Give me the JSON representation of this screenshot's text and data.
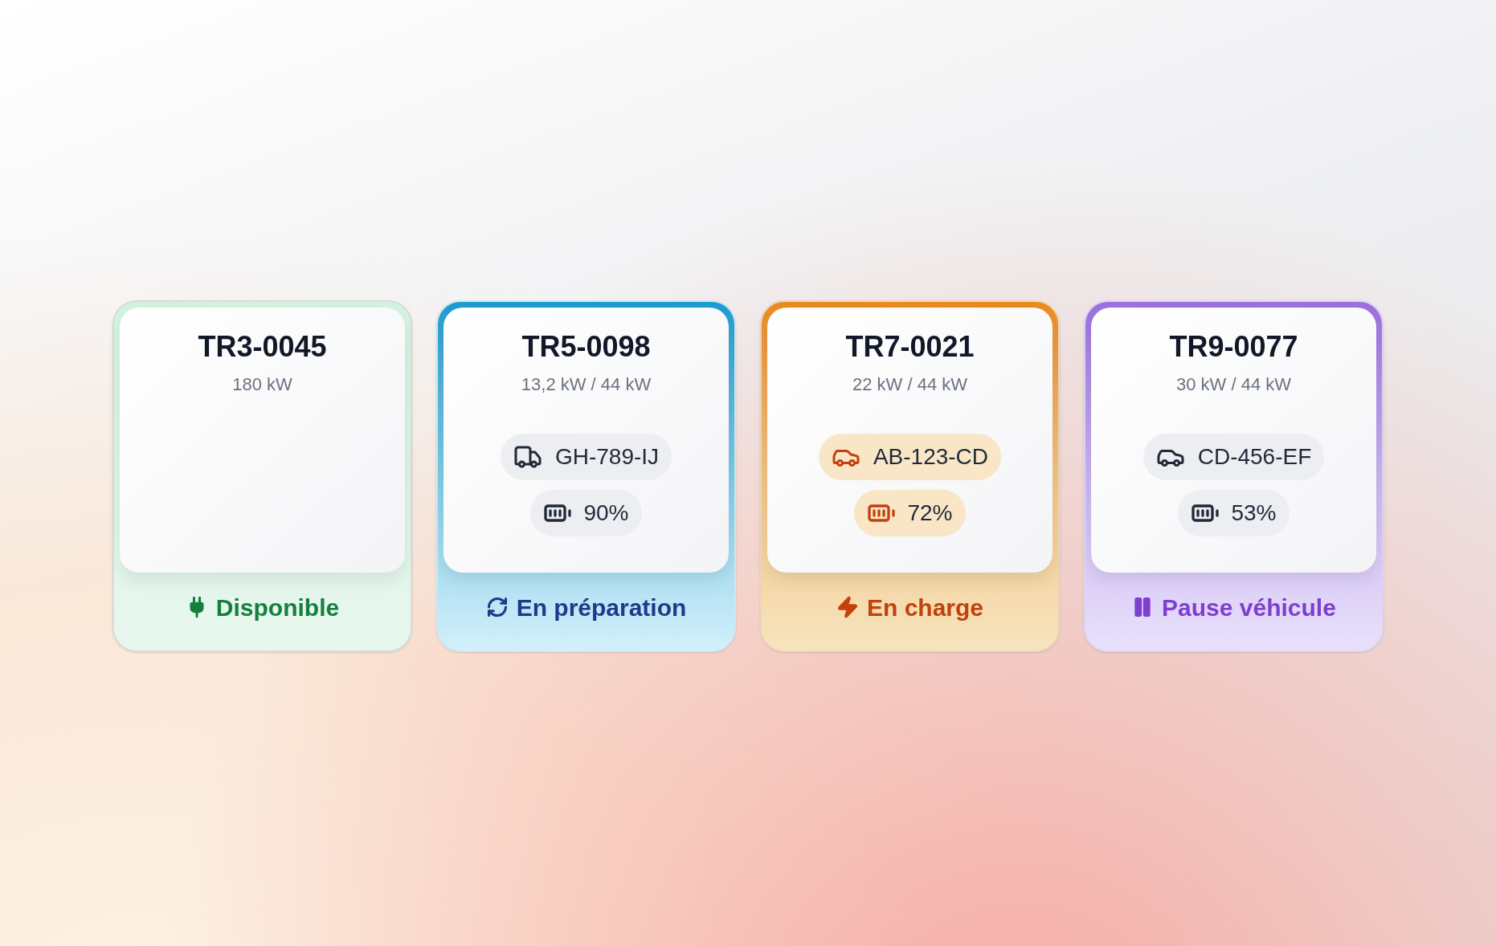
{
  "stations": [
    {
      "id": "TR3-0045",
      "power": "180 kW",
      "status": {
        "kind": "available",
        "label": "Disponible"
      }
    },
    {
      "id": "TR5-0098",
      "power": "13,2 kW / 44 kW",
      "vehicle": {
        "kind": "truck",
        "plate": "GH-789-IJ"
      },
      "battery": "90%",
      "status": {
        "kind": "preparing",
        "label": "En préparation"
      }
    },
    {
      "id": "TR7-0021",
      "power": "22 kW / 44 kW",
      "vehicle": {
        "kind": "car",
        "plate": "AB-123-CD"
      },
      "battery": "72%",
      "status": {
        "kind": "charging",
        "label": "En charge"
      }
    },
    {
      "id": "TR9-0077",
      "power": "30 kW / 44 kW",
      "vehicle": {
        "kind": "car",
        "plate": "CD-456-EF"
      },
      "battery": "53%",
      "status": {
        "kind": "paused",
        "label": "Pause véhicule"
      }
    }
  ]
}
